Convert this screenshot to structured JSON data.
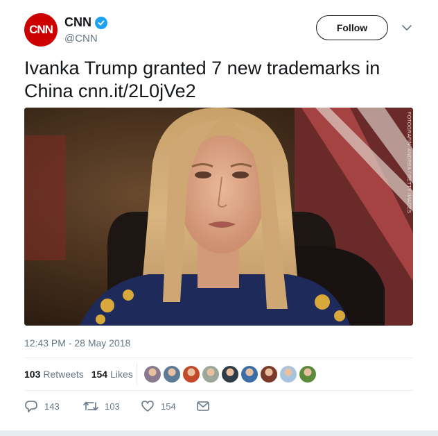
{
  "account": {
    "avatar_text": "CNN",
    "name": "CNN",
    "handle": "@CNN",
    "verified_icon": "verified-badge-icon",
    "brand_color": "#cc0000"
  },
  "header": {
    "follow_label": "Follow",
    "menu_icon": "chevron-down-icon"
  },
  "tweet": {
    "text": "Ivanka Trump granted 7 new trademarks in China cnn.it/2L0jVe2",
    "image_credit": "FOTOGRAFIN: ANDREA / GETTY IMAGES",
    "timestamp": "12:43 PM - 28 May 2018"
  },
  "stats": {
    "retweets_count": "103",
    "retweets_label": "Retweets",
    "likes_count": "154",
    "likes_label": "Likes",
    "liker_avatar_colors": [
      "#8a7a90",
      "#5d7a96",
      "#c24a2a",
      "#9aa79a",
      "#2f3b45",
      "#3b6fa8",
      "#7a3a2a",
      "#a7c3de",
      "#5b8a3a"
    ]
  },
  "actions": {
    "reply_count": "143",
    "retweet_count": "103",
    "like_count": "154",
    "accent": "#657786"
  }
}
